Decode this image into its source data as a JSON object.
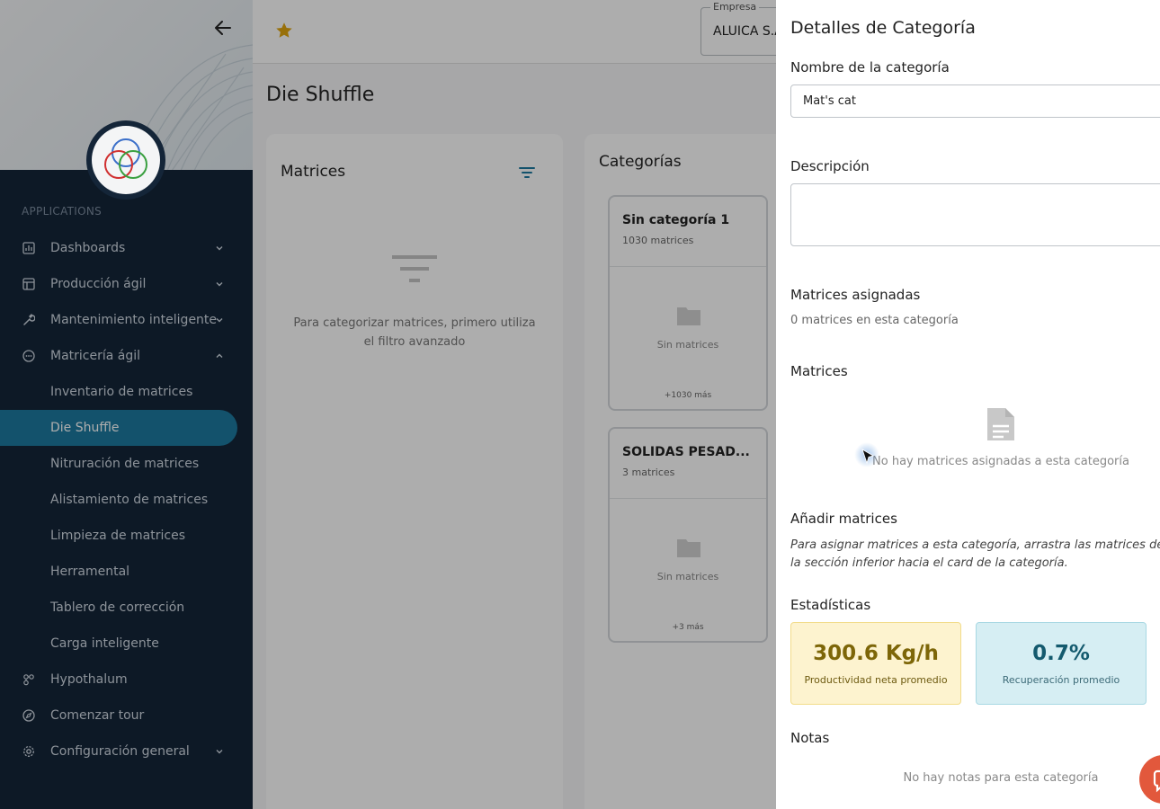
{
  "sidebar": {
    "section_label": "APPLICATIONS",
    "items": [
      {
        "label": "Dashboards",
        "icon": "bar-chart-icon",
        "chevron": "down"
      },
      {
        "label": "Producción ágil",
        "icon": "layout-icon",
        "chevron": "down"
      },
      {
        "label": "Mantenimiento inteligente",
        "icon": "wrench-icon",
        "chevron": "down"
      },
      {
        "label": "Matricería ágil",
        "icon": "dots-circle-icon",
        "chevron": "up"
      }
    ],
    "sub_items": [
      {
        "label": "Inventario de matrices"
      },
      {
        "label": "Die Shuffle",
        "active": true
      },
      {
        "label": "Nitruración de matrices"
      },
      {
        "label": "Alistamiento de matrices"
      },
      {
        "label": "Limpieza de matrices"
      },
      {
        "label": "Herramental"
      },
      {
        "label": "Tablero de corrección"
      },
      {
        "label": "Carga inteligente"
      }
    ],
    "bottom_items": [
      {
        "label": "Hypothalum",
        "icon": "network-icon"
      },
      {
        "label": "Comenzar tour",
        "icon": "compass-icon"
      },
      {
        "label": "Configuración general",
        "icon": "gear-icon",
        "chevron": "down"
      }
    ]
  },
  "topbar": {
    "company_legend": "Empresa",
    "company_value": "ALUICA S.A."
  },
  "page": {
    "title": "Die Shuffle"
  },
  "matrices_panel": {
    "title": "Matrices",
    "empty_text": "Para categorizar matrices, primero utiliza el filtro avanzado"
  },
  "categories_panel": {
    "title": "Categorías",
    "cards": [
      {
        "name": "Sin categoría 1",
        "count": "1030 matrices",
        "empty": "Sin matrices",
        "more": "+1030 más"
      },
      {
        "name": "SOLIDAS PESAD...",
        "count": "3 matrices",
        "empty": "Sin matrices",
        "more": "+3 más"
      }
    ]
  },
  "drawer": {
    "title": "Detalles de Categoría",
    "name_label": "Nombre de la categoría",
    "name_value": "Mat's cat",
    "description_label": "Descripción",
    "assigned_label": "Matrices asignadas",
    "assigned_count": "0 matrices en esta categoría",
    "matrices_label": "Matrices",
    "matrices_empty": "No hay matrices asignadas a esta categoría",
    "add_label": "Añadir matrices",
    "add_hint": "Para asignar matrices a esta categoría, arrastra las matrices de la sección inferior hacia el card de la categoría.",
    "stats_label": "Estadísticas",
    "stats": [
      {
        "value": "300.6 Kg/h",
        "label": "Productividad neta promedio"
      },
      {
        "value": "0.7%",
        "label": "Recuperación promedio"
      }
    ],
    "notes_label": "Notas",
    "notes_empty": "No hay notas para esta categoría"
  },
  "colors": {
    "sidebar_bg": "#142538",
    "active_item": "#1c7aa0",
    "star": "#e0a60f",
    "stat_prod_bg": "#fdf3cf",
    "stat_rec_bg": "#d6eef3",
    "fab": "#e2583c"
  }
}
